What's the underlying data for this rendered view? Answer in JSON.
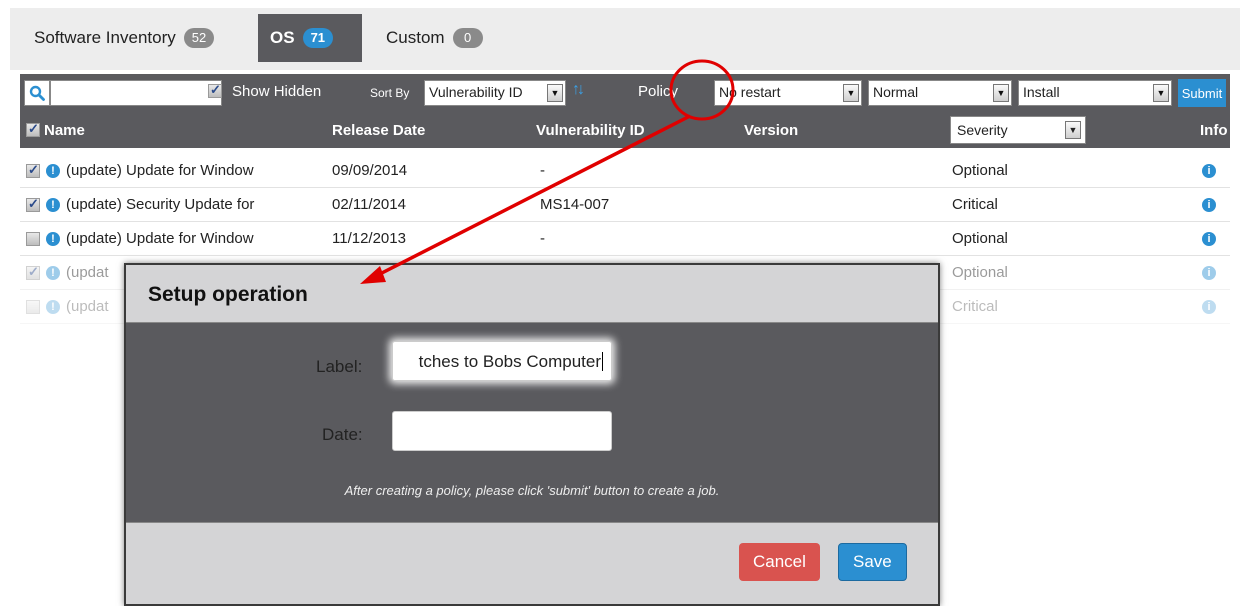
{
  "tabs": [
    {
      "label": "Software Inventory",
      "count": "52"
    },
    {
      "label": "OS",
      "count": "71"
    },
    {
      "label": "Custom",
      "count": "0"
    }
  ],
  "toolbar": {
    "search_value": "",
    "show_hidden_label": "Show Hidden",
    "sort_by_label": "Sort By",
    "sort_value": "Vulnerability ID",
    "policy_label": "Policy",
    "restart_value": "No restart",
    "priority_value": "Normal",
    "action_value": "Install",
    "submit_label": "Submit"
  },
  "table": {
    "headers": {
      "name": "Name",
      "release_date": "Release Date",
      "vulnerability_id": "Vulnerability ID",
      "version": "Version",
      "severity": "Severity",
      "info": "Info"
    },
    "rows": [
      {
        "name": "(update) Update for Window",
        "date": "09/09/2014",
        "vuln": "-",
        "severity": "Optional",
        "checked": true
      },
      {
        "name": "(update) Security Update for",
        "date": "02/11/2014",
        "vuln": "MS14-007",
        "severity": "Critical",
        "checked": true
      },
      {
        "name": "(update) Update for Window",
        "date": "11/12/2013",
        "vuln": "-",
        "severity": "Optional",
        "checked": false
      },
      {
        "name": "(updat",
        "date": "",
        "vuln": "",
        "severity": "Optional",
        "checked": true
      },
      {
        "name": "(updat",
        "date": "",
        "vuln": "",
        "severity": "Critical",
        "checked": false
      }
    ]
  },
  "dialog": {
    "title": "Setup operation",
    "label_label": "Label:",
    "label_value": "tches to Bobs Computer",
    "date_label": "Date:",
    "date_value": "",
    "hint": "After creating a policy, please click 'submit' button to create a job.",
    "cancel_label": "Cancel",
    "save_label": "Save"
  },
  "colors": {
    "header_bg": "#5a5a5e",
    "accent_blue": "#2b8fd1",
    "cancel_red": "#d9534f",
    "annotation_red": "#e00000"
  },
  "icons": {
    "search": "search-icon",
    "info": "info-icon",
    "sort": "sort-arrows-icon",
    "dropdown": "chevron-down-icon"
  }
}
